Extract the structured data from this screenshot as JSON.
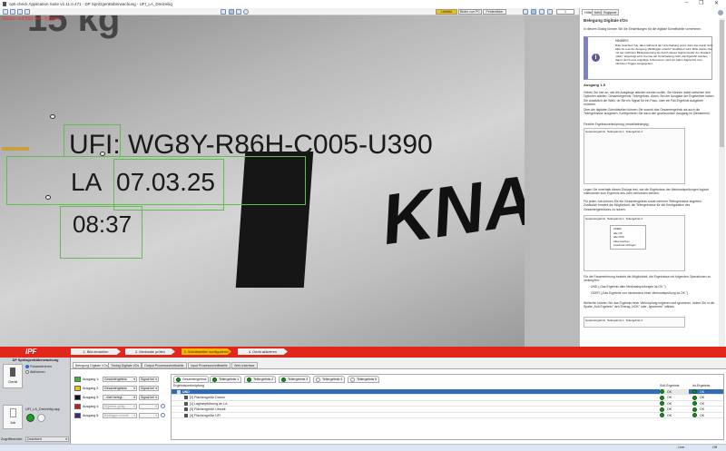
{
  "window": {
    "title": "opti-check Application Suite v2.11.0.471 - DP Spritzgerätüberwachung - UFI_LA_Dreizeilig",
    "minimize": "–",
    "maximize": "❐",
    "close": "✕"
  },
  "toolbar": {
    "mode_buttons": [
      "Livebild",
      "Bilder von PC",
      "Fehlerbilder"
    ],
    "frame_counter": "1"
  },
  "camera": {
    "status": "Warten auf Bild (ext. Trigger)...",
    "ocr_line1": "UFI: WG8Y-R86H-C005-U390",
    "ocr_la": "LA",
    "ocr_date": "07.03.25",
    "ocr_time": "08:37",
    "bg_top": "15 kg",
    "bg_brand": "KNAU"
  },
  "help": {
    "tabs": [
      "Hilfe",
      "Info",
      "Support"
    ],
    "title": "Belegung Digitale I/Os",
    "intro": "In diesem Dialog können Sie die Einstellungen für die digitale Schnittstelle vornehmen.",
    "note_title": "HINWEIS",
    "note_text": "Bitte beachten Sie, dass während der Unterhaltung eines Jobs das Gerät nicht aktiv ist und der Ausgang „Bildtrigger erlaubt\" deaktiviert wird. Bitte warten Sie mit der nächsten Bildauswertung bis durch dieses Signal wieder der Zustand „Aktiv\" angezeigt wird. Konnte die Unterhaltung nicht durchgeführt werden, dapur durch eine ungültige Jobnummer, wird ein Alarm-Signal bis zum nächsten Trigger ausgegeben.",
    "section1": "Ausgang 1-5",
    "p1": "Geben Sie hier an, wie die Ausgänge aktiviert werden sollen. Sie können dabei zwischen drei Optionen wählen: Gesamtergebnis, Teilergebnis, Alarm. Bei der Ausgabe der Ergebnisse haben Sie zusätzlich die Wahl, ob Sie ein Signal für ein Pass- oder ein Fail-Ergebnis ausgeben möchten.",
    "p2": "Über die digitalen Schnittstellen können Sie sowohl das Gesamtergebnis als auch die Teilergebnisse ausgeben. Konfigurieren Sie dazu den gewünschten Ausgang im Dienstmenü.",
    "section2": "Flexible Ergebnisverknüpfung (modellabhängig)",
    "p3": "Legen Sie innerhalb dieses Dialogs fest, wie die Ergebnisse der Merkmalsprüfungen logisch miteinander zum Ergebnis des Jobs verbunden werden.",
    "p4": "Für jeden Job können Sie ein Gesamtergebnis sowie mehrere Teilergebnisse angeben. Zusätzlich besteht die Möglichkeit, die Teilergebnisse für die Konfiguration des Gesamtergebnisses zu nutzen.",
    "p5": "Für die Parametrierung besteht die Möglichkeit, die Ergebnisse mit folgenden Operationen zu verknüpfen:",
    "bullets": [
      "UND („Das Ergebnis aller Merkmalsprüfungen ist OK.\")",
      "ODER („Das Ergebnis von mindestens einer Merkmalsprüfung ist OK.\")"
    ],
    "p6": "Weiterhin können Sie das Ergebnis einer Verknüpfung negieren und ignorieren, indem Sie in der Spalte „Soll-Ergebnis\" den Eintrag „NOK\" oder „Ignorieren\" wählen.",
    "shot_tabs": [
      "Gesamtergebnis",
      "Teilergebnis 1",
      "Teilergebnis 2"
    ],
    "menu_items": [
      "ODER",
      "alle OK",
      "alle NOK",
      "Alles löschen",
      "Ausdruck einfügen"
    ]
  },
  "steps": [
    "1. Bild einstellen",
    "2. Merkmale prüfen",
    "3. Schnittstellen konfigurieren",
    "4. Gerät aktivieren"
  ],
  "logo": "IPF",
  "left": {
    "title": "DP Spritzgerätüberwachung",
    "device_label": "Gerät",
    "radio_param": "Parametrieren",
    "radio_active": "Aktivieren",
    "job_file": "UFI_LA_Dreizeilig.app",
    "job_label": "Job",
    "access_label": "Zugriffsrechte:",
    "access_value": "Deaktiviert"
  },
  "bottom_tabs": [
    "Belegung Digitale I/Os",
    "Timing Digitale I/Os",
    "Output Prozessschnittstelle",
    "Input Prozessschnittstelle",
    "Web-Interface"
  ],
  "outputs": [
    {
      "label": "Ausgang 1:",
      "value": "Gesamtergebnis",
      "signal": "Signal bei",
      "color": "#3cb43c",
      "enabled": true
    },
    {
      "label": "Ausgang 2:",
      "value": "Gesamtergebnis",
      "signal": "Signal bei",
      "color": "#f0c020",
      "enabled": true
    },
    {
      "label": "Ausgang 3:",
      "value": "- nicht belegt -",
      "signal": "Signal bei",
      "color": "#111111",
      "enabled": true
    },
    {
      "label": "Ausgang 4:",
      "value": "Ergebnis gültig",
      "signal": "",
      "color": "#c81e1e",
      "enabled": false
    },
    {
      "label": "Ausgang 5:",
      "value": "Bildtrigger erlaubt",
      "signal": "",
      "color": "#3a2a7a",
      "enabled": false
    }
  ],
  "results": {
    "tabs": [
      "Gesamtergebnis",
      "Teilergebnis 1",
      "Teilergebnis 2",
      "Teilergebnis 3",
      "Teilergebnis 4",
      "Teilergebnis 5"
    ],
    "tree_label": "Ergebnisverknüpfung",
    "col_target": "Soll-Ergebnis",
    "col_actual": "Ist-Ergebnis",
    "rows": [
      {
        "name": "UND",
        "target": "OK",
        "actual": "OK"
      },
      {
        "name": "[2] Flächengröße Datum",
        "target": "OK",
        "actual": "OK"
      },
      {
        "name": "[1] Lageanpführung an LA",
        "target": "OK",
        "actual": "OK"
      },
      {
        "name": "[3] Flächengröße Uhrzeit",
        "target": "OK",
        "actual": "OK"
      },
      {
        "name": "[4] Flächengröße UFI",
        "target": "OK",
        "actual": "OK"
      }
    ]
  },
  "status": {
    "mode": "- Live -",
    "right": "Off"
  }
}
